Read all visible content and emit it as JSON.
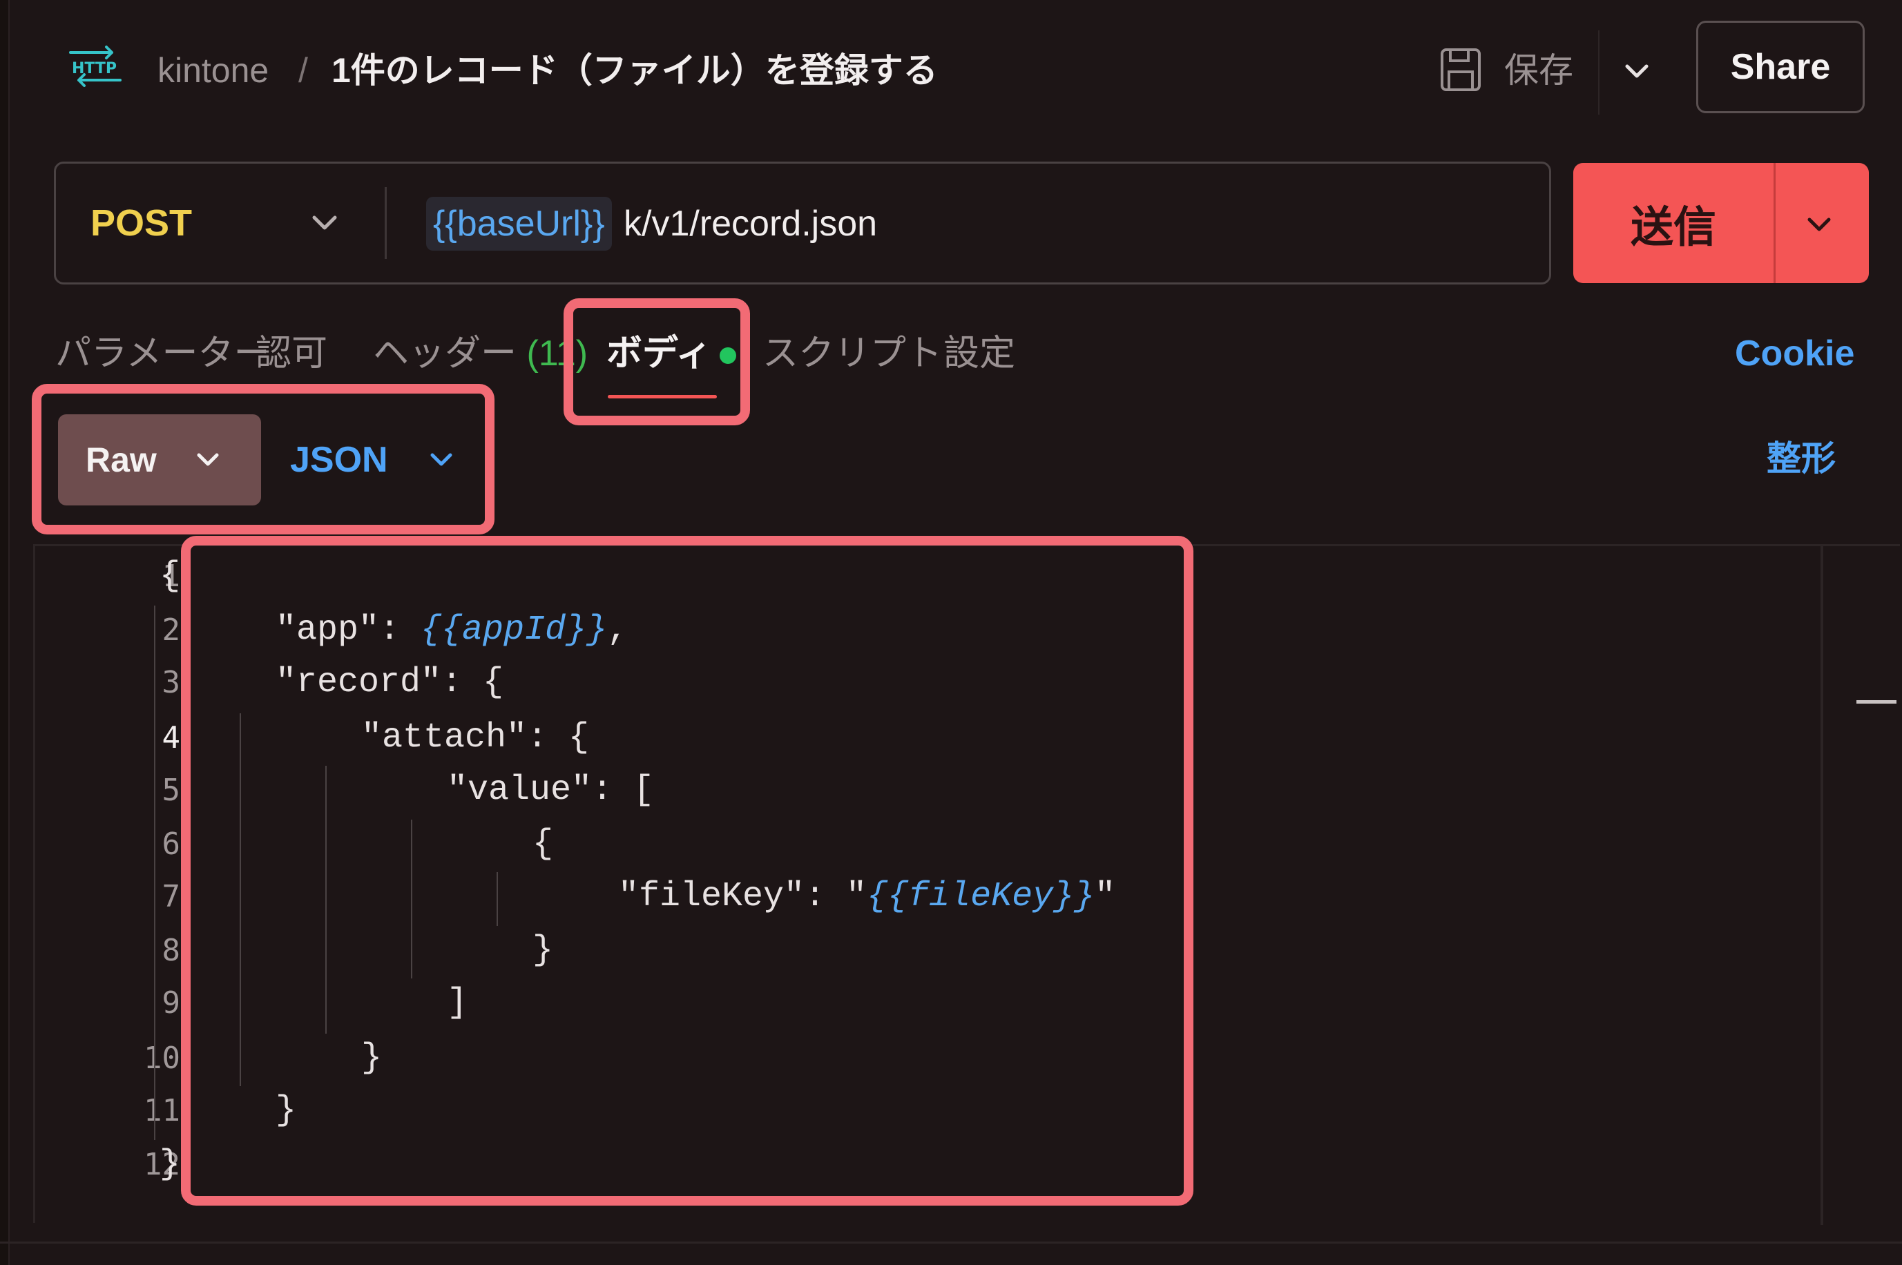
{
  "header": {
    "protocol_badge": "HTTP",
    "breadcrumb_parent": "kintone",
    "breadcrumb_separator": "/",
    "request_title": "1件のレコード（ファイル）を登録する",
    "save_label": "保存",
    "share_label": "Share"
  },
  "request": {
    "method": "POST",
    "url_variable": "{{baseUrl}}",
    "url_path": "k/v1/record.json",
    "send_label": "送信"
  },
  "tabs": {
    "params": "パラメーター",
    "auth": "認可",
    "headers": "ヘッダー",
    "headers_count": "(11)",
    "body": "ボディ",
    "scripts": "スクリプト",
    "settings": "設定",
    "cookie": "Cookie",
    "active": "body"
  },
  "body_options": {
    "mode": "Raw",
    "language": "JSON",
    "format_label": "整形"
  },
  "editor": {
    "line_numbers": [
      "1",
      "2",
      "3",
      "4",
      "5",
      "6",
      "7",
      "8",
      "9",
      "10",
      "11",
      "12"
    ],
    "active_line": "4",
    "lines": [
      {
        "prefix": "{"
      },
      {
        "prefix": "\"app\": ",
        "var": "{{appId}}",
        "suffix": ","
      },
      {
        "prefix": "\"record\": {"
      },
      {
        "prefix": "\"attach\": {"
      },
      {
        "prefix": "\"value\": ["
      },
      {
        "prefix": "{"
      },
      {
        "prefix": "\"fileKey\": \"",
        "var": "{{fileKey}}",
        "suffix": "\""
      },
      {
        "prefix": "}"
      },
      {
        "prefix": "]"
      },
      {
        "prefix": "}"
      },
      {
        "prefix": "}"
      },
      {
        "prefix": "}"
      }
    ]
  },
  "colors": {
    "background": "#1d1516",
    "accent_send": "#f45555",
    "method_post": "#f0d04e",
    "link_blue": "#4fa3f7",
    "variable_blue": "#5aa8f0",
    "body_dot_green": "#22c55e",
    "highlight_box": "#f26b75",
    "raw_button": "#6e4d4e"
  },
  "icons": {
    "http": "http-badge-icon",
    "save": "floppy-disk-icon",
    "dropdown": "chevron-down-icon"
  }
}
